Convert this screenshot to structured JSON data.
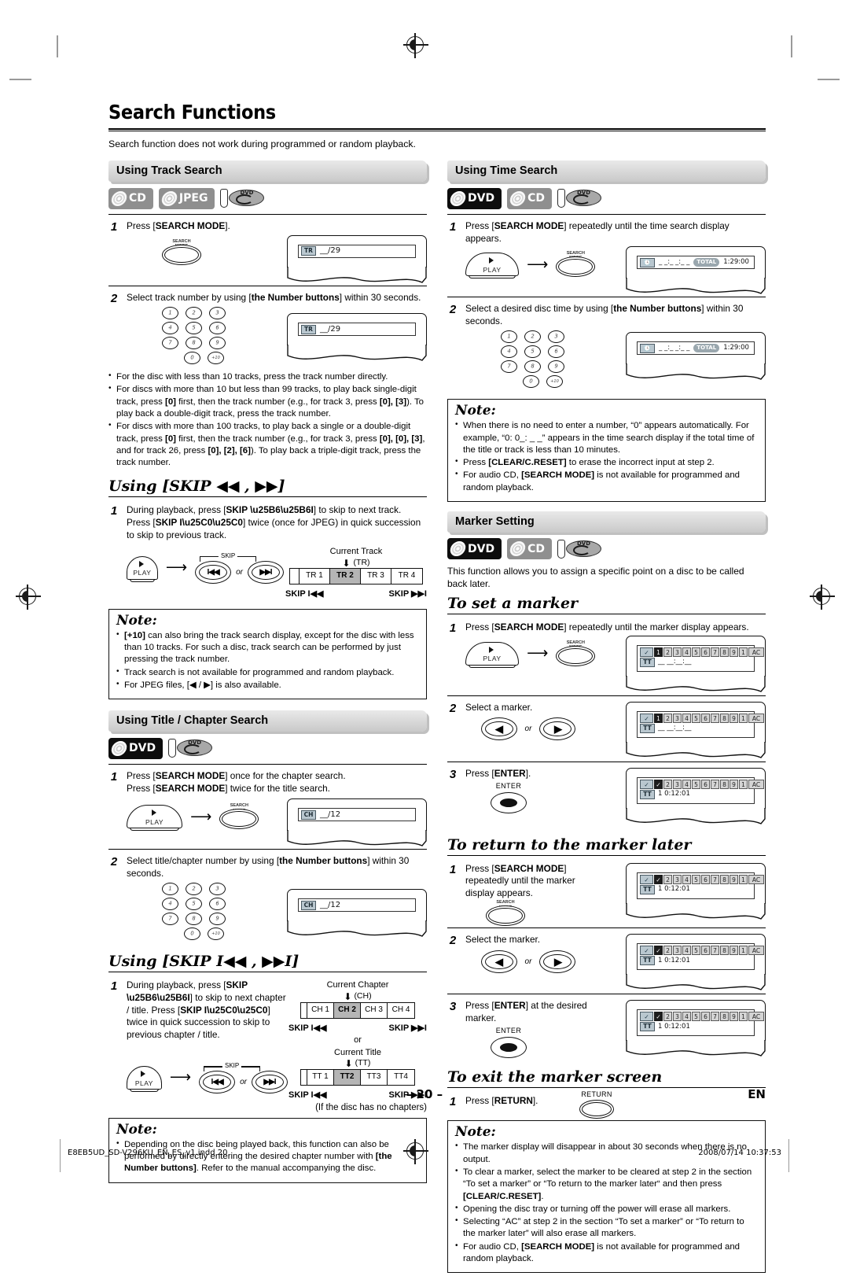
{
  "document": {
    "title": "Search Functions",
    "intro": "Search function does not work during programmed or random playback.",
    "page_number": "– 20 –",
    "language_mark": "EN",
    "footer_file": "E8EB5UD_SD-V296KU_EN_ES_v1.indd   20",
    "footer_date": "2008/07/14   10:37:53"
  },
  "left_column": {
    "track_search": {
      "heading": "Using Track Search",
      "badges": [
        "CD",
        "JPEG",
        "DVD-R"
      ],
      "step1": {
        "num": "1",
        "text_a": "Press [",
        "text_b": "SEARCH MODE",
        "text_c": "].",
        "button": "SEARCH MODE",
        "display_tag": "TR",
        "display_value": "__/29"
      },
      "step2": {
        "num": "2",
        "text": "Select track number by using [the Number buttons] within 30 seconds.",
        "display_tag": "TR",
        "display_value": "__/29"
      },
      "bullets": [
        "For the disc with less than 10 tracks, press the track number directly.",
        "For discs with more than 10 but less than 99 tracks, to play back single-digit track, press [0] first, then the track number (e.g., for track 3, press [0], [3]). To play back a double-digit track, press the track number.",
        "For discs with more than 100 tracks, to play back a single or a double-digit track, press [0] first, then the track number (e.g., for track 3, press [0], [0], [3], and for track 26, press [0], [2], [6]). To play back a triple-digit track, press the track number."
      ]
    },
    "skip_track": {
      "heading": "Using [SKIP ◀◀ , ▶▶]",
      "step1": {
        "num": "1",
        "line1": "During playback, press [SKIP ▶▶I] to skip to next track.",
        "line2": "Press [SKIP I◀◀] twice (once for JPEG) in quick succession to skip to previous track."
      },
      "play_label": "PLAY",
      "skip_bracket_label": "SKIP",
      "or_label": "or",
      "diagram": {
        "current_label": "Current Track",
        "unit_label": "(TR)",
        "cells": [
          "TR 1",
          "TR 2",
          "TR 3",
          "TR 4"
        ],
        "highlight_index": 1,
        "skip_back": "SKIP I◀◀",
        "skip_fwd": "SKIP ▶▶I"
      }
    },
    "note_track": {
      "title": "Note:",
      "items": [
        "[+10] can also bring the track search display, except for the disc with less than 10 tracks. For such a disc, track search can be performed by just pressing the track number.",
        "Track search is not available for programmed and random playback.",
        "For JPEG files, [◀ / ▶] is also available."
      ]
    },
    "title_chapter_search": {
      "heading": "Using Title / Chapter Search",
      "badges": [
        "DVD",
        "DVD-R"
      ],
      "step1": {
        "num": "1",
        "line1": "Press [SEARCH MODE] once for the chapter search.",
        "line2": "Press [SEARCH MODE] twice for the title search.",
        "display_tag": "CH",
        "display_value": "__/12"
      },
      "step2": {
        "num": "2",
        "text": "Select title/chapter number by using [the Number buttons] within 30 seconds.",
        "display_tag": "CH",
        "display_value": "__/12"
      }
    },
    "skip_chapter": {
      "heading": "Using [SKIP I◀◀ , ▶▶I]",
      "step1": {
        "num": "1",
        "line1": "During playback, press [SKIP ▶▶I] to skip to next chapter / title.",
        "line2": "Press [SKIP I◀◀] twice in quick succession to skip to previous chapter / title."
      },
      "play_label": "PLAY",
      "skip_bracket_label": "SKIP",
      "or_label": "or",
      "chapter_diagram": {
        "current_label": "Current Chapter",
        "unit_label": "(CH)",
        "cells": [
          "CH 1",
          "CH 2",
          "CH 3",
          "CH 4"
        ],
        "highlight_index": 1,
        "skip_back": "SKIP I◀◀",
        "skip_fwd": "SKIP ▶▶I"
      },
      "or_between": "or",
      "title_diagram": {
        "current_label": "Current Title",
        "unit_label": "(TT)",
        "cells": [
          "TT 1",
          "TT2",
          "TT3",
          "TT4"
        ],
        "highlight_index": 1,
        "skip_back": "SKIP I◀◀",
        "skip_fwd": "SKIP ▶▶I"
      },
      "no_chapters_note": "(If the disc has no chapters)"
    },
    "note_chapter": {
      "title": "Note:",
      "items": [
        "Depending on the disc being played back, this function can also be performed by directly entering the desired chapter number with [the Number buttons]. Refer to the manual accompanying the disc."
      ]
    }
  },
  "right_column": {
    "time_search": {
      "heading": "Using Time Search",
      "badges": [
        "DVD",
        "CD",
        "DVD-R"
      ],
      "step1": {
        "num": "1",
        "text": "Press [SEARCH MODE] repeatedly until the time search display appears.",
        "display_value": "_ _:_ _:_ _",
        "total_label": "TOTAL",
        "total_value": "1:29:00"
      },
      "step2": {
        "num": "2",
        "text": "Select a desired disc time by using [the Number buttons] within 30 seconds.",
        "display_value": "_ _:_ _:_ _",
        "total_label": "TOTAL",
        "total_value": "1:29:00"
      }
    },
    "note_time": {
      "title": "Note:",
      "items": [
        "When there is no need to enter a number, “0” appears automatically. For example, “0: 0_: _ _” appears in the time search display if the total time of the title or track is less than 10 minutes.",
        "Press [CLEAR/C.RESET] to erase the incorrect input at step 2.",
        "For audio CD, [SEARCH MODE] is not available for programmed and random playback."
      ]
    },
    "marker_setting": {
      "heading": "Marker Setting",
      "badges": [
        "DVD",
        "CD",
        "DVD-R"
      ],
      "description": "This function allows you to assign a specific point on a disc to be called back later."
    },
    "to_set_marker": {
      "heading": "To set a marker",
      "steps": [
        {
          "num": "1",
          "text": "Press [SEARCH MODE] repeatedly until the marker display appears.",
          "marker_tag": "TT",
          "marker_value": "__ __:__:__",
          "active": 0,
          "checked": []
        },
        {
          "num": "2",
          "text": "Select a marker.",
          "marker_tag": "TT",
          "marker_value": "__ __:__:__",
          "active": 0,
          "checked": []
        },
        {
          "num": "3",
          "text": "Press [ENTER].",
          "marker_tag": "TT",
          "marker_value": "1  0:12:01",
          "active": 0,
          "checked": [
            0
          ]
        }
      ],
      "marker_cells": [
        "1",
        "2",
        "3",
        "4",
        "5",
        "6",
        "7",
        "8",
        "9",
        "1",
        "AC"
      ],
      "enter_label": "ENTER"
    },
    "to_return_marker": {
      "heading": "To return to the marker later",
      "steps": [
        {
          "num": "1",
          "text": "Press [SEARCH MODE] repeatedly until the marker display appears.",
          "marker_tag": "TT",
          "marker_value": "1  0:12:01",
          "checked": [
            0
          ]
        },
        {
          "num": "2",
          "text": "Select the marker.",
          "marker_tag": "TT",
          "marker_value": "1  0:12:01",
          "checked": [
            0
          ]
        },
        {
          "num": "3",
          "text": "Press [ENTER] at the desired marker.",
          "marker_tag": "TT",
          "marker_value": "1  0:12:01",
          "checked": [
            0
          ]
        }
      ]
    },
    "to_exit_marker": {
      "heading": "To exit the marker screen",
      "step1": {
        "num": "1",
        "text": "Press [RETURN].",
        "button": "RETURN"
      }
    },
    "note_marker": {
      "title": "Note:",
      "items": [
        "The marker display will disappear in about 30 seconds when there is no output.",
        "To clear a marker, select the marker to be cleared at step 2 in the section “To set a marker” or “To return to the marker later” and then press [CLEAR/C.RESET].",
        "Opening the disc tray or turning off the power will erase all markers.",
        "Selecting “AC” at step 2 in the section “To set a marker” or “To return to the marker later” will also erase all markers.",
        "For audio CD, [SEARCH MODE] is not available for programmed and random playback."
      ]
    }
  },
  "keypad": {
    "rows": [
      [
        "1",
        "2",
        "3"
      ],
      [
        "4",
        "5",
        "6"
      ],
      [
        "7",
        "8",
        "9"
      ],
      [
        "0",
        "+10"
      ]
    ]
  },
  "labels": {
    "search_mode_button": "SEARCH MODE",
    "play_button": "PLAY",
    "or": "or",
    "skip": "SKIP"
  },
  "colors": {
    "bar_light": "#e9e9e9",
    "bar_dark": "#c9c9c9",
    "badge_dark": "#0d0d0d",
    "badge_grey": "#8f8f8f",
    "highlight": "#b5b5b5",
    "panel_tag": "#b9c7cf"
  }
}
